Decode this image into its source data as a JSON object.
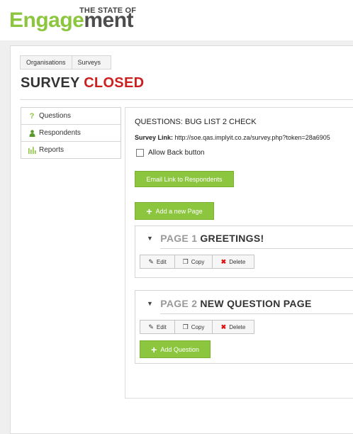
{
  "logo": {
    "top": "THE STATE OF",
    "part1": "Engage",
    "part2": "ment"
  },
  "tabs": [
    {
      "label": "Organisations"
    },
    {
      "label": "Surveys"
    }
  ],
  "title": {
    "prefix": "SURVEY",
    "status": "CLOSED"
  },
  "sidebar": {
    "items": [
      {
        "label": "Questions",
        "icon": "question-icon"
      },
      {
        "label": "Respondents",
        "icon": "person-icon"
      },
      {
        "label": "Reports",
        "icon": "bar-chart-icon"
      }
    ]
  },
  "main": {
    "heading": "QUESTIONS: BUG LIST 2 CHECK",
    "survey_link_label": "Survey Link:",
    "survey_link_url": "http://soe.qas.implyit.co.za/survey.php?token=28a6905",
    "allow_back": "Allow Back button",
    "email_button": "Email Link to Respondents",
    "add_page_button": "Add a new Page",
    "pages": [
      {
        "number": "PAGE 1",
        "name": "GREETINGS!"
      },
      {
        "number": "PAGE 2",
        "name": "NEW QUESTION PAGE"
      }
    ],
    "page_actions": {
      "edit": "Edit",
      "copy": "Copy",
      "delete": "Delete"
    },
    "add_question_button": "Add Question"
  },
  "colors": {
    "brand_green": "#8cc63f",
    "closed_red": "#cc1f1f",
    "logo_dark": "#4d4d4d"
  }
}
